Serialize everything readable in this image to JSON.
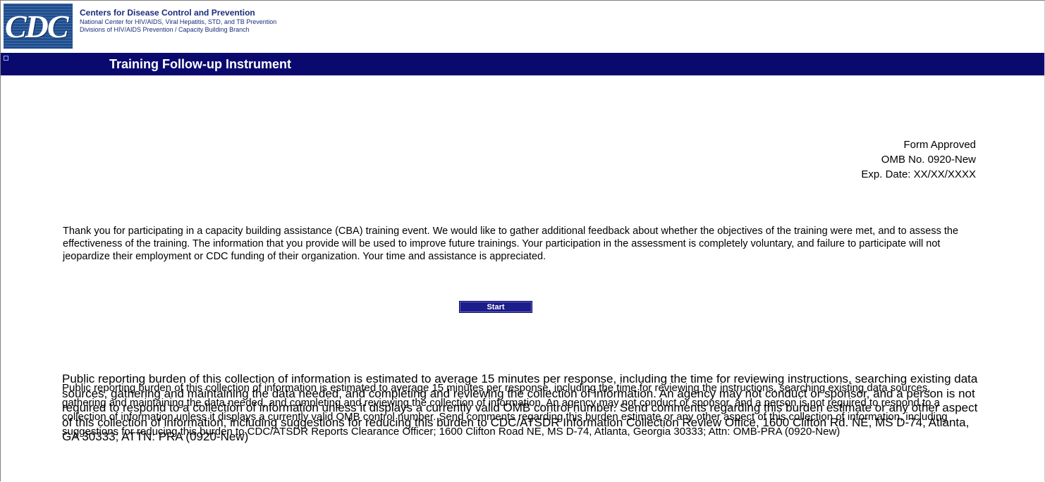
{
  "header": {
    "logo_text": "CDC",
    "org_title": "Centers for Disease Control and Prevention",
    "org_line2": "National Center for HIV/AIDS, Viral Hepatitis, STD, and TB Prevention",
    "org_line3": "Divisions of HIV/AIDS Prevention / Capacity Building Branch"
  },
  "banner": {
    "title": "Training Follow-up Instrument"
  },
  "approval": {
    "line1": "Form Approved",
    "line2": "OMB No. 0920-New",
    "line3": "Exp. Date: XX/XX/XXXX"
  },
  "intro": "Thank you for participating in a capacity building assistance (CBA) training event. We would like to gather additional feedback about whether the objectives of the training were met, and to assess the effectiveness of the training. The information that you provide will be used to improve future trainings. Your participation in the assessment is completely voluntary, and failure to participate will not jeopardize their employment or CDC funding of their organization. Your time and assistance is appreciated.",
  "start_button": "Start",
  "burden_a": "Public reporting burden of this collection of information is estimated to average 15 minutes per response, including the time for reviewing instructions, searching existing data sources, gathering and maintaining the data needed, and completing and reviewing the collection of information. An agency may not conduct or sponsor, and a person is not required to respond to a collection of information unless it displays a currently valid OMB control number. Send comments regarding this burden estimate or any other aspect of this collection of information, including suggestions for reducing this burden to CDC/ATSDR Information Collection Review Office, 1600 Clifton Rd. NE, MS D-74, Atlanta, GA 30333; ATTN: PRA (0920-New)",
  "burden_b": "Public reporting burden of this collection of information is estimated to average 15 minutes per response, including the time for reviewing the instructions, searching existing data sources, gathering and maintaining the data needed, and completing and reviewing the collection of information. An agency may not conduct or sponsor, and a person is not required to respond to a collection of information unless it displays a currently valid OMB control number. Send comments regarding this burden estimate or any other aspect of this collection of information, including suggestions for reducing this burden to CDC/ATSDR Reports Clearance Officer; 1600 Clifton Road NE, MS D-74, Atlanta, Georgia 30333; Attn: OMB-PRA (0920-New)"
}
